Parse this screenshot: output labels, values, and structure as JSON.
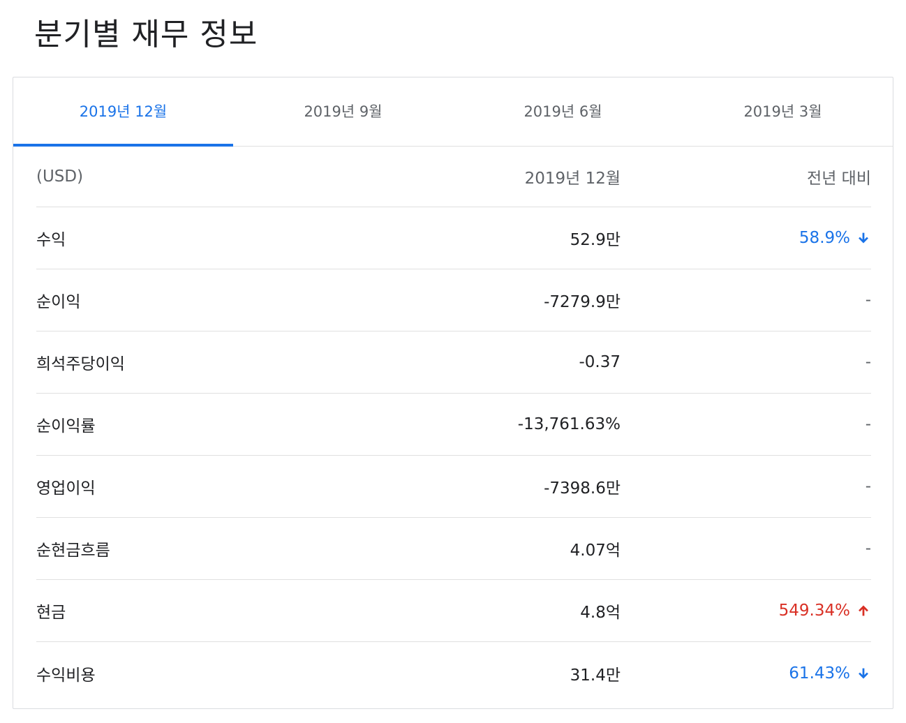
{
  "title": "분기별 재무 정보",
  "tabs": [
    {
      "label": "2019년 12월",
      "active": true
    },
    {
      "label": "2019년 9월",
      "active": false
    },
    {
      "label": "2019년 6월",
      "active": false
    },
    {
      "label": "2019년 3월",
      "active": false
    }
  ],
  "table": {
    "headers": {
      "label": "(USD)",
      "value": "2019년 12월",
      "change": "전년 대비"
    },
    "rows": [
      {
        "label": "수익",
        "value": "52.9만",
        "change": "58.9%",
        "trend": "down",
        "icon": "arrow-down-icon"
      },
      {
        "label": "순이익",
        "value": "-7279.9만",
        "change": "-",
        "trend": "none"
      },
      {
        "label": "희석주당이익",
        "value": "-0.37",
        "change": "-",
        "trend": "none"
      },
      {
        "label": "순이익률",
        "value": "-13,761.63%",
        "change": "-",
        "trend": "none"
      },
      {
        "label": "영업이익",
        "value": "-7398.6만",
        "change": "-",
        "trend": "none"
      },
      {
        "label": "순현금흐름",
        "value": "4.07억",
        "change": "-",
        "trend": "none"
      },
      {
        "label": "현금",
        "value": "4.8억",
        "change": "549.34%",
        "trend": "up",
        "icon": "arrow-up-icon"
      },
      {
        "label": "수익비용",
        "value": "31.4만",
        "change": "61.43%",
        "trend": "down",
        "icon": "arrow-down-icon"
      }
    ]
  },
  "colors": {
    "accent": "#1a73e8",
    "negative": "#d93025",
    "text": "#202124",
    "muted": "#5f6368"
  }
}
